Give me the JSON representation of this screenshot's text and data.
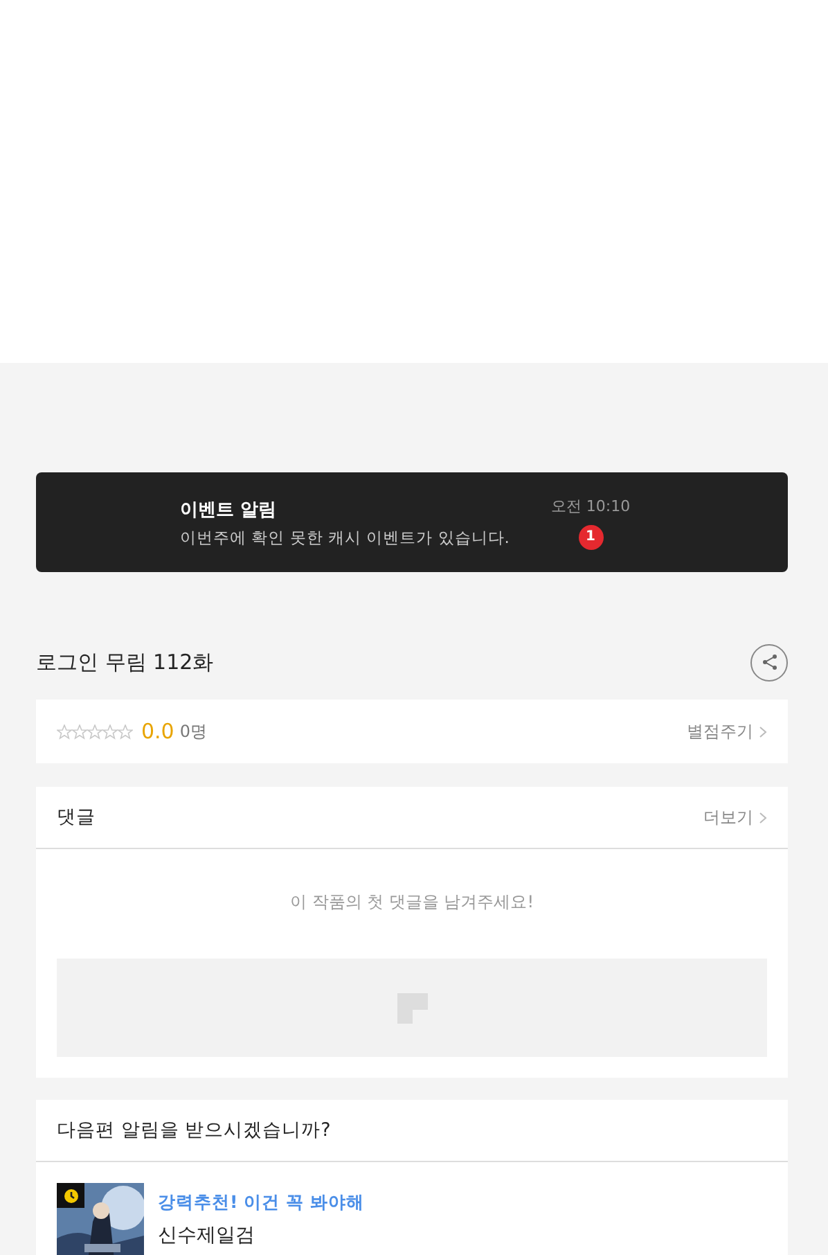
{
  "event": {
    "title": "이벤트 알림",
    "message": "이번주에 확인 못한 캐시 이벤트가 있습니다.",
    "time": "오전 10:10",
    "badge": "1"
  },
  "episode": {
    "title": "로그인 무림 112화"
  },
  "rating": {
    "stars": 0,
    "score": "0.0",
    "count": "0명",
    "action": "별점주기"
  },
  "comments": {
    "title": "댓글",
    "more": "더보기",
    "empty": "이 작품의 첫 댓글을 남겨주세요!"
  },
  "next": {
    "question": "다음편 알림을 받으시겠습니까?",
    "item": {
      "kind": "picture",
      "tag": "강력추천! 이건 꼭 봐야해",
      "title": "신수제일검"
    }
  }
}
